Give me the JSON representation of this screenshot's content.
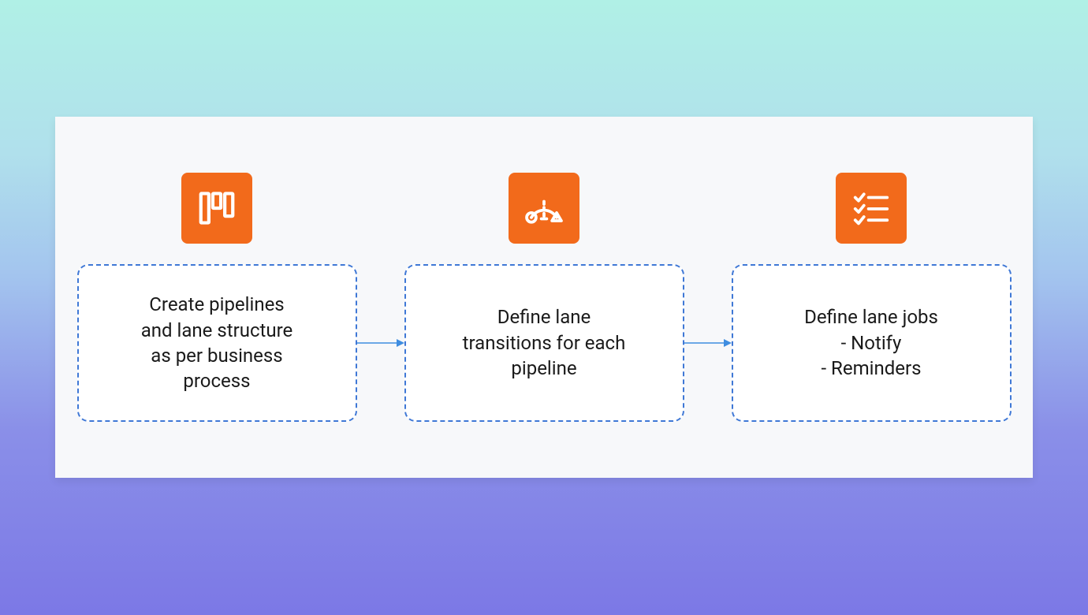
{
  "diagram": {
    "steps": [
      {
        "icon": "kanban-board-icon",
        "text": "Create pipelines\nand lane structure\nas per business\nprocess"
      },
      {
        "icon": "state-transition-icon",
        "text": "Define lane\ntransitions for each\npipeline"
      },
      {
        "icon": "checklist-icon",
        "text": "Define lane jobs\n- Notify\n- Reminders"
      }
    ],
    "colors": {
      "icon_bg": "#f26a1b",
      "card_border": "#3f78d6",
      "panel_bg": "#f7f8fa",
      "arrow": "#3f8de0"
    }
  }
}
